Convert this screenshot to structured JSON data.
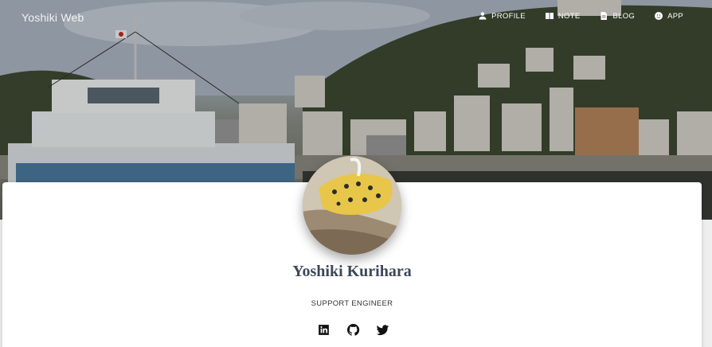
{
  "header": {
    "brand": "Yoshiki Web",
    "menu": [
      {
        "label": "PROFILE",
        "icon": "person-icon"
      },
      {
        "label": "NOTE",
        "icon": "book-icon"
      },
      {
        "label": "BLOG",
        "icon": "document-icon"
      },
      {
        "label": "APP",
        "icon": "face-icon"
      }
    ]
  },
  "profile": {
    "name": "Yoshiki Kurihara",
    "role": "SUPPORT ENGINEER",
    "socials": [
      {
        "icon": "linkedin-icon"
      },
      {
        "icon": "github-icon"
      },
      {
        "icon": "twitter-icon"
      }
    ]
  },
  "colors": {
    "name_text": "#3c4858",
    "card_bg": "#ffffff",
    "page_bg": "#eeeeee"
  }
}
